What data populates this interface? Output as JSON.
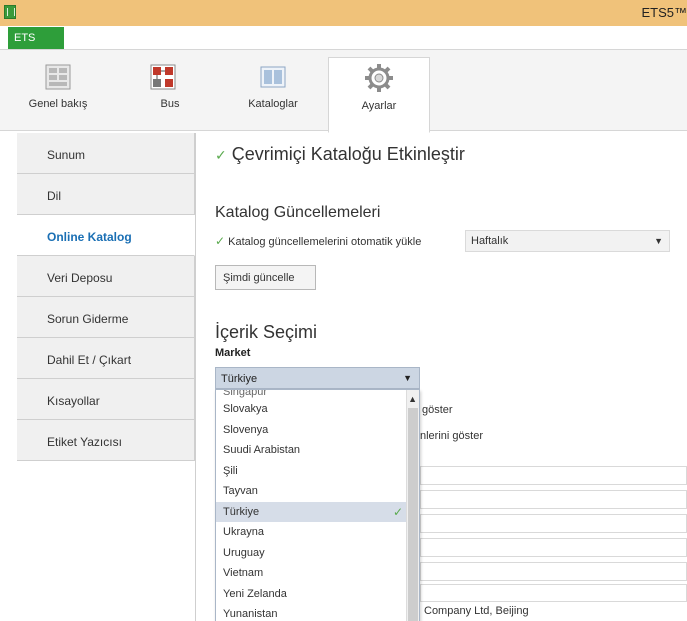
{
  "window": {
    "title": "ETS5™"
  },
  "app_tab": {
    "label": "ETS"
  },
  "ribbon": {
    "tabs": [
      {
        "label": "Genel bakış",
        "icon": "overview-icon"
      },
      {
        "label": "Bus",
        "icon": "bus-icon"
      },
      {
        "label": "Kataloglar",
        "icon": "catalogs-icon"
      },
      {
        "label": "Ayarlar",
        "icon": "gear-icon",
        "active": true
      }
    ]
  },
  "sidebar": {
    "items": [
      {
        "label": "Sunum"
      },
      {
        "label": "Dil"
      },
      {
        "label": "Online Katalog",
        "active": true
      },
      {
        "label": "Veri Deposu"
      },
      {
        "label": "Sorun Giderme"
      },
      {
        "label": "Dahil Et / Çıkart"
      },
      {
        "label": "Kısayollar"
      },
      {
        "label": "Etiket Yazıcısı"
      }
    ]
  },
  "main": {
    "enable_checkbox_label": "Çevrimiçi Kataloğu Etkinleştir",
    "updates_heading": "Katalog Güncellemeleri",
    "auto_update_label": "Katalog güncellemelerini otomatik yükle",
    "frequency_value": "Haftalık",
    "update_now_button": "Şimdi güncelle",
    "content_heading": "İçerik Seçimi",
    "market_label": "Market",
    "market_value": "Türkiye",
    "partial_text_1": "göster",
    "partial_text_2": "nlerini göster",
    "footer_partial": "Company Ltd, Beijing"
  },
  "market_dropdown": {
    "partial_top": "Singapur",
    "options": [
      "Slovakya",
      "Slovenya",
      "Suudi Arabistan",
      "Şili",
      "Tayvan",
      "Türkiye",
      "Ukrayna",
      "Uruguay",
      "Vietnam",
      "Yeni Zelanda",
      "Yunanistan"
    ],
    "selected": "Türkiye"
  },
  "colors": {
    "titlebar": "#f0c27a",
    "ets_tab": "#2e9e3a",
    "active_link": "#1a6fb4",
    "checkmark": "#5aaa4e",
    "selection": "#d6dde8"
  }
}
